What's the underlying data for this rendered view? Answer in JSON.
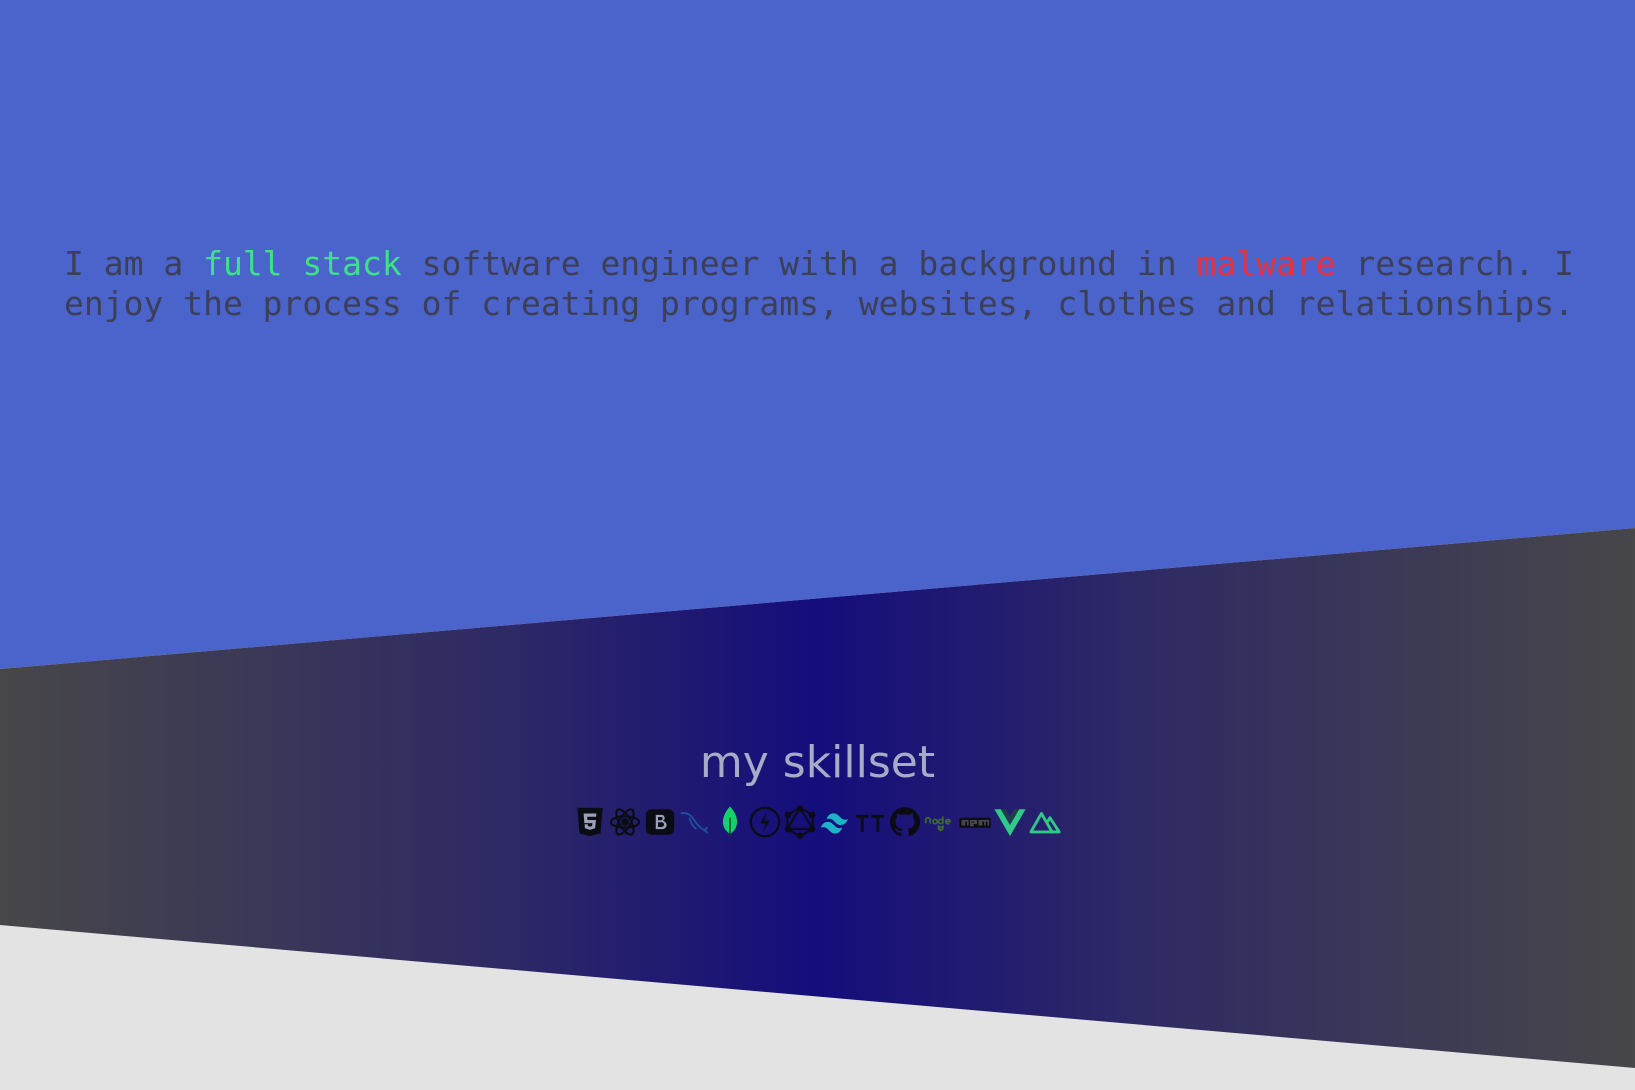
{
  "intro": {
    "prefix": "I am a ",
    "highlight_1": "full stack",
    "middle": " software engineer with a background in ",
    "highlight_2": "malware",
    "suffix_1": " research. I",
    "line_2": "enjoy the process of creating programs, websites, clothes and relationships."
  },
  "skills": {
    "heading": "my skillset",
    "icons": [
      "html5-icon",
      "react-icon",
      "bootstrap-icon",
      "mysql-icon",
      "mongodb-icon",
      "fastify-icon",
      "graphql-icon",
      "tailwindcss-icon",
      "typescript-icon",
      "github-icon",
      "nodejs-icon",
      "npm-icon",
      "vue-icon",
      "nuxt-icon"
    ]
  },
  "colors": {
    "top_band": "#4a64cc",
    "middle_band_center": "#140d7c",
    "middle_band_edge": "#474749",
    "bottom_band": "#e3e3e3",
    "intro_text": "#3c3f55",
    "highlight_green": "#3ee089",
    "highlight_red": "#e8303a",
    "heading_text": "#a7acc6"
  }
}
